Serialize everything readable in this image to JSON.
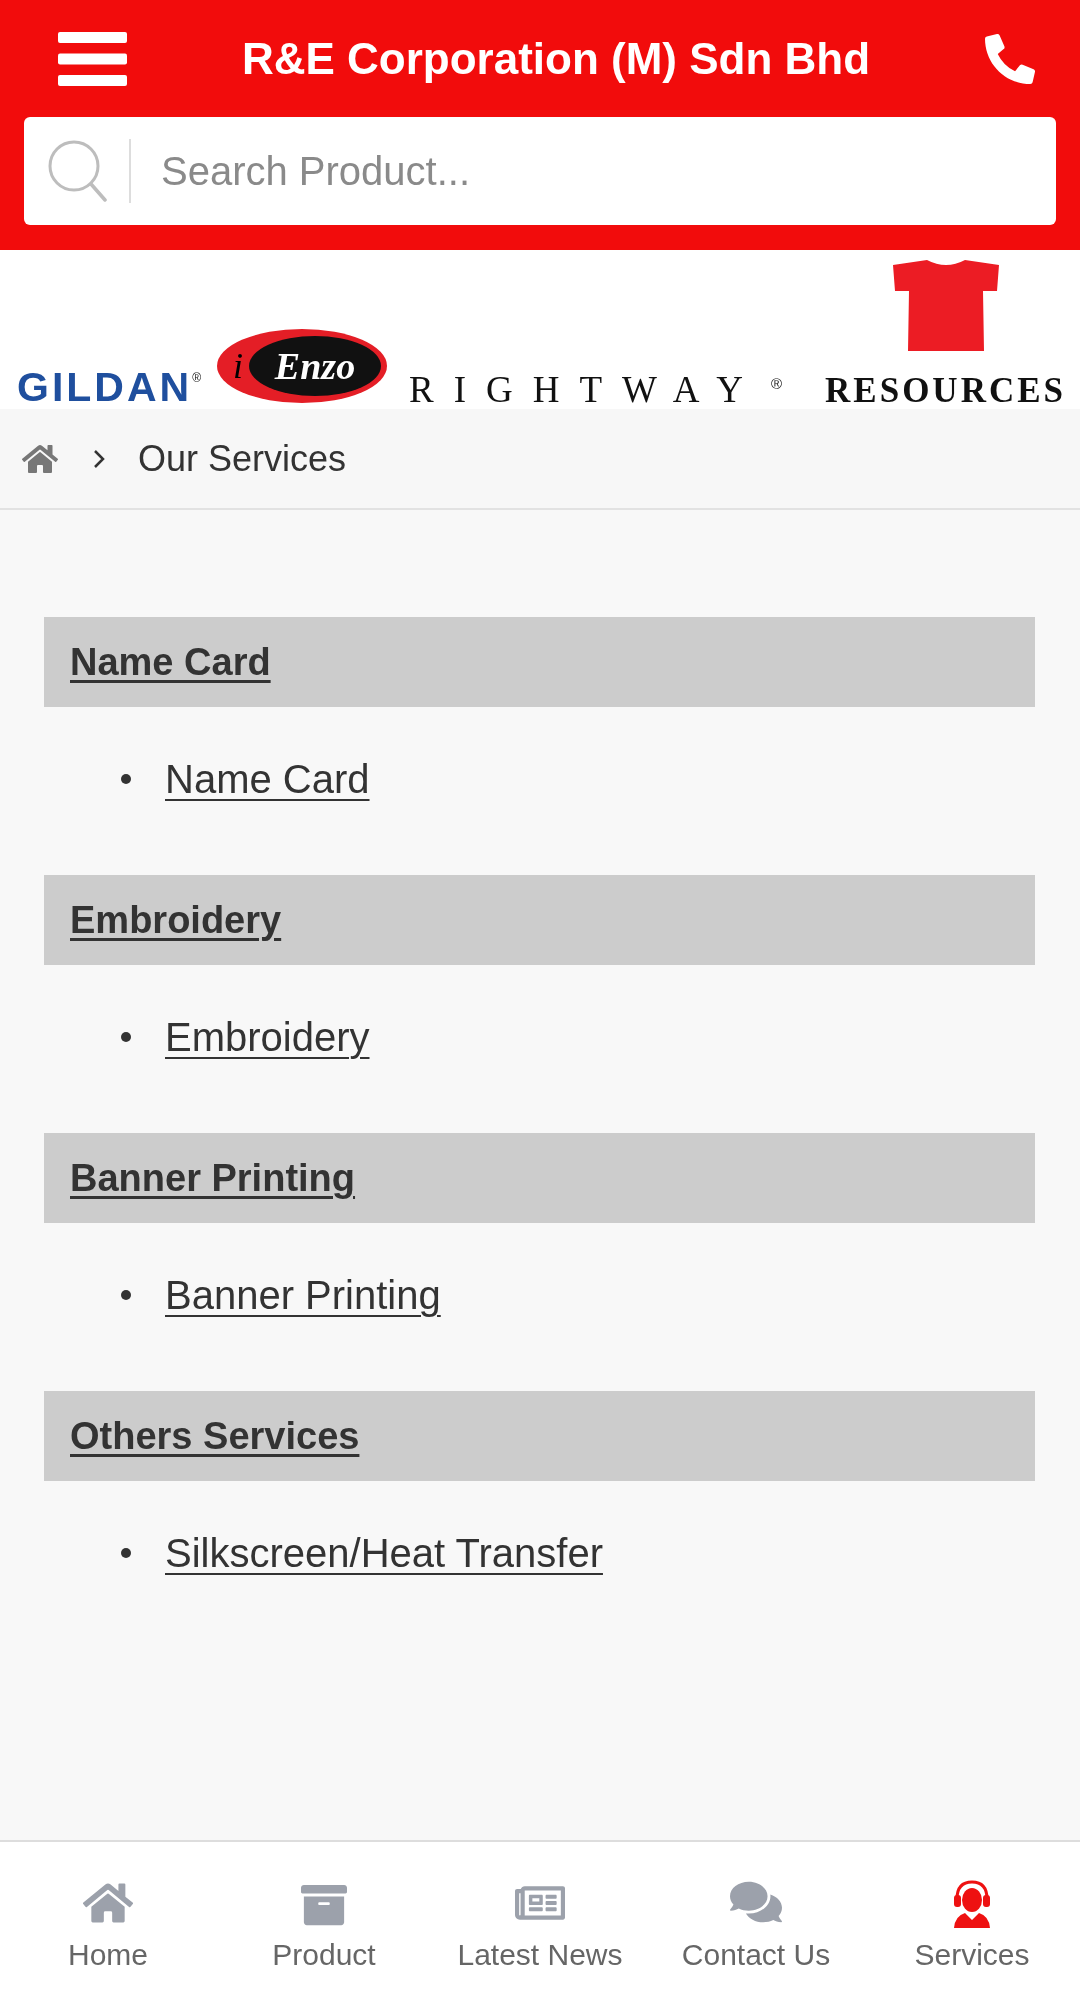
{
  "header": {
    "title": "R&E Corporation (M) Sdn Bhd"
  },
  "search": {
    "placeholder": "Search Product..."
  },
  "brand_banner": {
    "logos": [
      {
        "kind": "sans",
        "text": "GILDAN",
        "mark": "®"
      },
      {
        "kind": "oval",
        "prefix": "i",
        "text": "Enzo"
      },
      {
        "kind": "spaced",
        "text": "RIGHTWAY",
        "mark": "®"
      },
      {
        "kind": "shirt",
        "text": "RESOURCES"
      }
    ]
  },
  "breadcrumb": {
    "current": "Our Services"
  },
  "sections": [
    {
      "title": "Name Card",
      "items": [
        "Name Card"
      ]
    },
    {
      "title": "Embroidery",
      "items": [
        "Embroidery"
      ]
    },
    {
      "title": "Banner Printing",
      "items": [
        "Banner Printing"
      ]
    },
    {
      "title": "Others Services",
      "items": [
        "Silkscreen/Heat Transfer"
      ]
    }
  ],
  "bottom_nav": [
    {
      "label": "Home",
      "selected": false
    },
    {
      "label": "Product",
      "selected": false
    },
    {
      "label": "Latest News",
      "selected": false
    },
    {
      "label": "Contact Us",
      "selected": false
    },
    {
      "label": "Services",
      "selected": true
    }
  ]
}
